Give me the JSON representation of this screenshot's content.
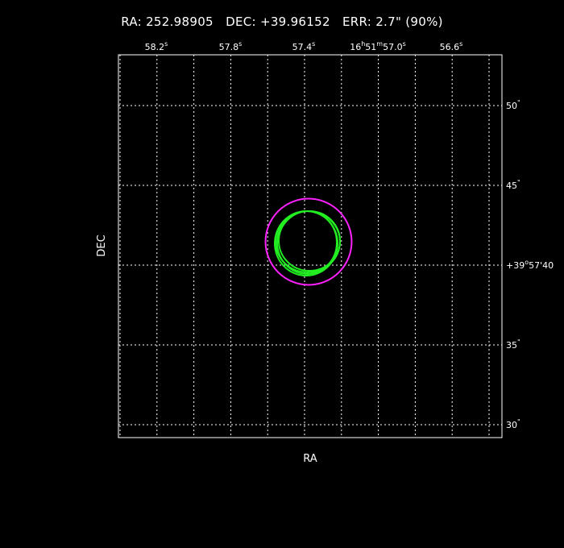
{
  "header": {
    "ra_label": "RA:",
    "ra_value": "252.98905",
    "dec_label": "DEC:",
    "dec_value": "+39.96152",
    "err_label": "ERR:",
    "err_value": "2.7\" (90%)"
  },
  "chart_data": {
    "type": "scatter",
    "title": "",
    "xlabel": "RA",
    "ylabel": "DEC",
    "grid": true,
    "x_tick_labels": [
      {
        "base": "58.2",
        "sup": "s"
      },
      {
        "base": "57.8",
        "sup": "s"
      },
      {
        "base": "57.4",
        "sup": "s"
      },
      {
        "prefix": "16",
        "h": "h",
        "mid": "51",
        "m": "m",
        "base": "57.0",
        "sup": "s"
      },
      {
        "base": "56.6",
        "sup": "s"
      }
    ],
    "y_tick_labels": [
      {
        "base": "50",
        "sup": "\""
      },
      {
        "base": "45",
        "sup": "\""
      },
      {
        "prefix": "+39",
        "deg": "o",
        "mid": "57",
        "min": "'",
        "base": "40",
        "sup": ""
      },
      {
        "base": "35",
        "sup": "\""
      },
      {
        "base": "30",
        "sup": "\""
      }
    ],
    "source_position": {
      "ra_deg": 252.98905,
      "dec_deg": 39.96152
    },
    "error_radius_arcsec": 2.7,
    "colors": {
      "error_circle": "#ff22ff",
      "source_ellipses": "#22ee22",
      "grid": "#ffffff",
      "frame": "#ffffff"
    }
  }
}
